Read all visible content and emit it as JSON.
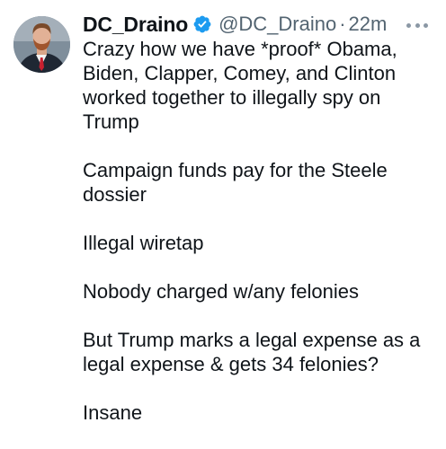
{
  "tweet": {
    "display_name": "DC_Draino",
    "handle": "@DC_Draino",
    "separator": "·",
    "time": "22m",
    "paragraphs": [
      "Crazy how we have *proof* Obama, Biden, Clapper, Comey, and Clinton worked together to illegally spy on Trump",
      "Campaign funds pay for the Steele dossier",
      "Illegal wiretap",
      "Nobody charged w/any felonies",
      "But Trump marks a legal expense as a legal expense & gets 34 felonies?",
      "Insane"
    ]
  },
  "icons": {
    "verified": "verified-badge-icon",
    "more": "more-options-icon"
  },
  "colors": {
    "verified_badge": "#1d9bf0",
    "secondary_text": "#536471",
    "primary_text": "#0f1419"
  }
}
